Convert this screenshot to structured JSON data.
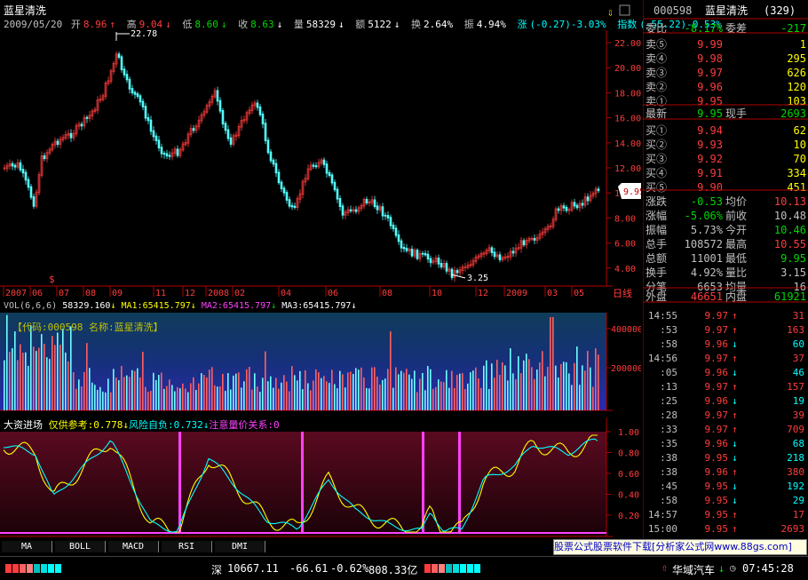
{
  "stock": {
    "name": "蓝星清洗",
    "code": "000598",
    "full_title": "000598 蓝星清洗(329)"
  },
  "info": {
    "date": "2009/05/20",
    "open_label": "开",
    "open": "8.96",
    "high_label": "高",
    "high": "9.04",
    "low_label": "低",
    "low": "8.60",
    "close_label": "收",
    "close": "8.63",
    "vol_label": "量",
    "vol": "58329",
    "amt_label": "额",
    "amt": "5122",
    "turn_label": "换",
    "turn": "2.64%",
    "amp_label": "振",
    "amp": "4.94%",
    "chg_label": "涨",
    "chg": "(-0.27)-3.03%",
    "idx_label": "指数",
    "idx": "(-55.22)-0.53%"
  },
  "price_chart": {
    "yticks": [
      "22.00",
      "20.00",
      "18.00",
      "16.00",
      "14.00",
      "12.00",
      "10.00",
      "8.00",
      "6.00",
      "4.00"
    ],
    "high_mark": "22.78",
    "low_mark": "3.25",
    "current_tag": "9.95",
    "xlabels": [
      "2007",
      "06",
      "07",
      "08",
      "09",
      "11",
      "12",
      "2008",
      "02",
      "04",
      "06",
      "08",
      "10",
      "12",
      "2009",
      "03",
      "05"
    ],
    "period": "日线",
    "flag": "$"
  },
  "volume_panel": {
    "header_label": "VOL(6,6,6)",
    "vol_value": "58329.160",
    "ma1": "MA1:65415.797",
    "ma2": "MA2:65415.797",
    "ma3": "MA3:65415.797",
    "legend": "【代码:000598 名称:蓝星清洗】",
    "yticks": [
      "400000",
      "200000"
    ]
  },
  "indicator_panel": {
    "name": "大资进场",
    "p1": "仅供参考:0.778",
    "p2": "风险自负:0.732",
    "p3": "注意量价关系:0",
    "yticks": [
      "1.00",
      "0.80",
      "0.60",
      "0.40",
      "0.20"
    ]
  },
  "tabs": [
    "MA",
    "BOLL",
    "MACD",
    "RSI",
    "DMI"
  ],
  "quote": {
    "weibi_label": "委比",
    "weibi": "-8.17%",
    "weicha_label": "委差",
    "weicha": "-217",
    "asks": [
      {
        "label": "卖⑤",
        "price": "9.99",
        "vol": "1"
      },
      {
        "label": "卖④",
        "price": "9.98",
        "vol": "295"
      },
      {
        "label": "卖③",
        "price": "9.97",
        "vol": "626"
      },
      {
        "label": "卖②",
        "price": "9.96",
        "vol": "120"
      },
      {
        "label": "卖①",
        "price": "9.95",
        "vol": "103"
      }
    ],
    "latest_label": "最新",
    "latest": "9.95",
    "xianshou_label": "现手",
    "xianshou": "2693",
    "bids": [
      {
        "label": "买①",
        "price": "9.94",
        "vol": "62"
      },
      {
        "label": "买②",
        "price": "9.93",
        "vol": "10"
      },
      {
        "label": "买③",
        "price": "9.92",
        "vol": "70"
      },
      {
        "label": "买④",
        "price": "9.91",
        "vol": "334"
      },
      {
        "label": "买⑤",
        "price": "9.90",
        "vol": "451"
      }
    ],
    "stats": [
      {
        "l1": "涨跌",
        "v1": "-0.53",
        "c1": "green",
        "l2": "均价",
        "v2": "10.13",
        "c2": "red"
      },
      {
        "l1": "涨幅",
        "v1": "-5.06%",
        "c1": "green",
        "l2": "前收",
        "v2": "10.48",
        "c2": "gry"
      },
      {
        "l1": "振幅",
        "v1": "5.73%",
        "c1": "gry",
        "l2": "今开",
        "v2": "10.46",
        "c2": "green"
      },
      {
        "l1": "总手",
        "v1": "108572",
        "c1": "gry",
        "l2": "最高",
        "v2": "10.55",
        "c2": "red"
      },
      {
        "l1": "总额",
        "v1": "11001",
        "c1": "gry",
        "l2": "最低",
        "v2": "9.95",
        "c2": "green"
      },
      {
        "l1": "换手",
        "v1": "4.92%",
        "c1": "gry",
        "l2": "量比",
        "v2": "3.15",
        "c2": "gry"
      },
      {
        "l1": "分笔",
        "v1": "6653",
        "c1": "gry",
        "l2": "均量",
        "v2": "16",
        "c2": "gry"
      }
    ],
    "waipan_label": "外盘",
    "waipan": "46651",
    "neipan_label": "内盘",
    "neipan": "61921",
    "ticks": [
      {
        "t": "14:55",
        "p": "9.97",
        "a": "↑",
        "v": "31",
        "c": "red"
      },
      {
        "t": ":53",
        "p": "9.97",
        "a": "↑",
        "v": "163",
        "c": "red"
      },
      {
        "t": ":58",
        "p": "9.96",
        "a": "↓",
        "v": "60",
        "c": "cyan"
      },
      {
        "t": "14:56",
        "p": "9.97",
        "a": "↑",
        "v": "37",
        "c": "red"
      },
      {
        "t": ":05",
        "p": "9.96",
        "a": "↓",
        "v": "46",
        "c": "cyan"
      },
      {
        "t": ":13",
        "p": "9.97",
        "a": "↑",
        "v": "157",
        "c": "red"
      },
      {
        "t": ":25",
        "p": "9.96",
        "a": "↓",
        "v": "19",
        "c": "cyan"
      },
      {
        "t": ":28",
        "p": "9.97",
        "a": "↑",
        "v": "39",
        "c": "red"
      },
      {
        "t": ":33",
        "p": "9.97",
        "a": "↑",
        "v": "709",
        "c": "red"
      },
      {
        "t": ":35",
        "p": "9.96",
        "a": "↓",
        "v": "68",
        "c": "cyan"
      },
      {
        "t": ":38",
        "p": "9.95",
        "a": "↓",
        "v": "218",
        "c": "cyan"
      },
      {
        "t": ":38",
        "p": "9.96",
        "a": "↑",
        "v": "380",
        "c": "red"
      },
      {
        "t": ":45",
        "p": "9.95",
        "a": "↓",
        "v": "192",
        "c": "cyan"
      },
      {
        "t": ":58",
        "p": "9.95",
        "a": "↓",
        "v": "29",
        "c": "cyan"
      },
      {
        "t": "14:57",
        "p": "9.95",
        "a": "↑",
        "v": "17",
        "c": "red"
      },
      {
        "t": "15:00",
        "p": "9.95",
        "a": "↑",
        "v": "2693",
        "c": "red"
      }
    ]
  },
  "status": {
    "market": "深",
    "index": "10667.11",
    "change": "-66.61",
    "pct": "-0.62%",
    "amount": "808.33亿",
    "stock_name": "华域汽车",
    "time": "07:45:28"
  },
  "banner": "股票公式股票软件下载[分析家公式网www.88gs.com]",
  "colors": {
    "up": "#ff3c3c",
    "down": "#54ffff",
    "ma_white": "#ffffff",
    "ma_yellow": "#ffff00",
    "ma_magenta": "#ff40ff",
    "grid": "#800000"
  }
}
